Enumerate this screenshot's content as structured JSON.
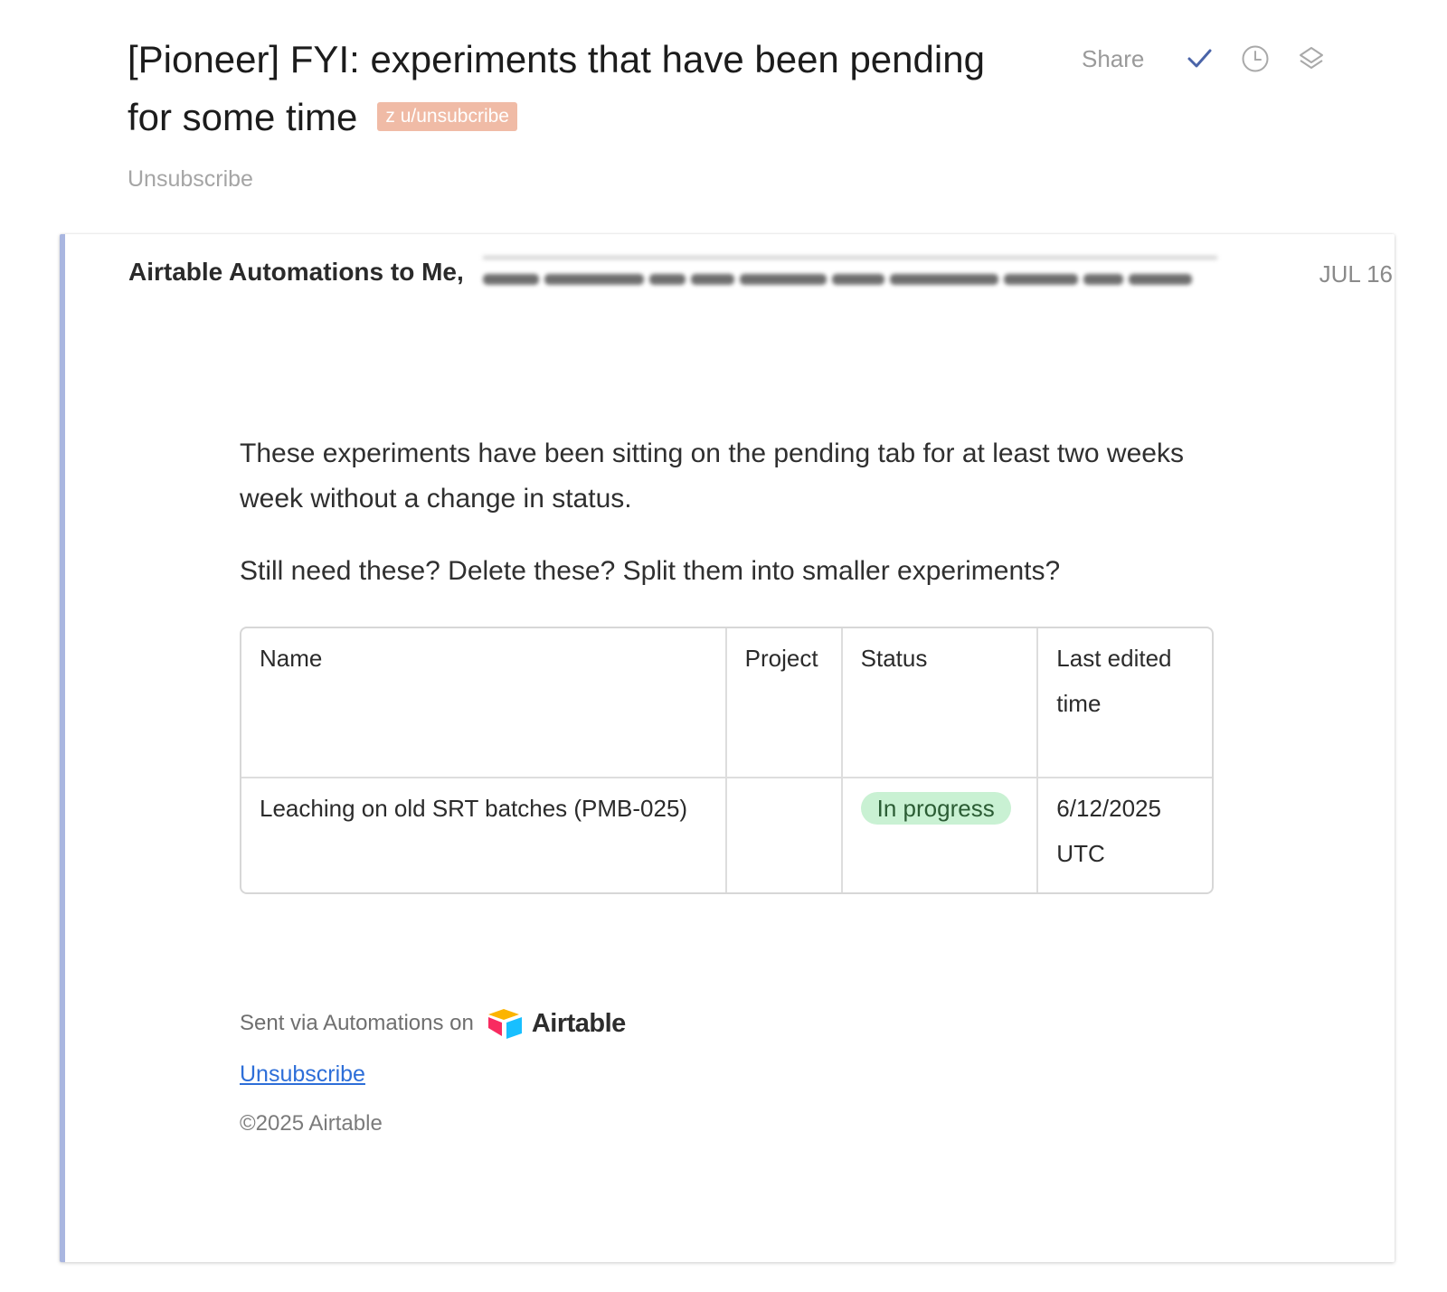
{
  "header": {
    "subject_line1": "[Pioneer] FYI: experiments that have been pending",
    "subject_line2": "for some time",
    "label": "z u/unsubcribe",
    "share_label": "Share",
    "unsubscribe_label": "Unsubscribe"
  },
  "message": {
    "sender": "Airtable Automations to Me,",
    "date": "JUL 16"
  },
  "body": {
    "paragraph1": "These experiments have been sitting on the pending tab for at least two weeks week without a change in status.",
    "paragraph2": "Still need these? Delete these? Split them into smaller experiments?"
  },
  "table": {
    "headers": [
      "Name",
      "Project",
      "Status",
      "Last edited time"
    ],
    "rows": [
      {
        "name": "Leaching on old SRT batches (PMB-025)",
        "project": "",
        "status": "In progress",
        "last_edited": "6/12/2025 UTC"
      }
    ]
  },
  "footer": {
    "sent_via": "Sent via Automations on",
    "brand": "Airtable",
    "unsubscribe": "Unsubscribe",
    "copyright": "©2025 Airtable"
  },
  "colors": {
    "label_bg": "#f0bba6",
    "accent_border": "#a9b6e0",
    "status_pill_bg": "#c9f1d3",
    "link": "#2d6ed8",
    "check_icon": "#4a64a8"
  },
  "icons": [
    "check-icon",
    "clock-icon",
    "layers-icon",
    "airtable-logo-icon"
  ]
}
